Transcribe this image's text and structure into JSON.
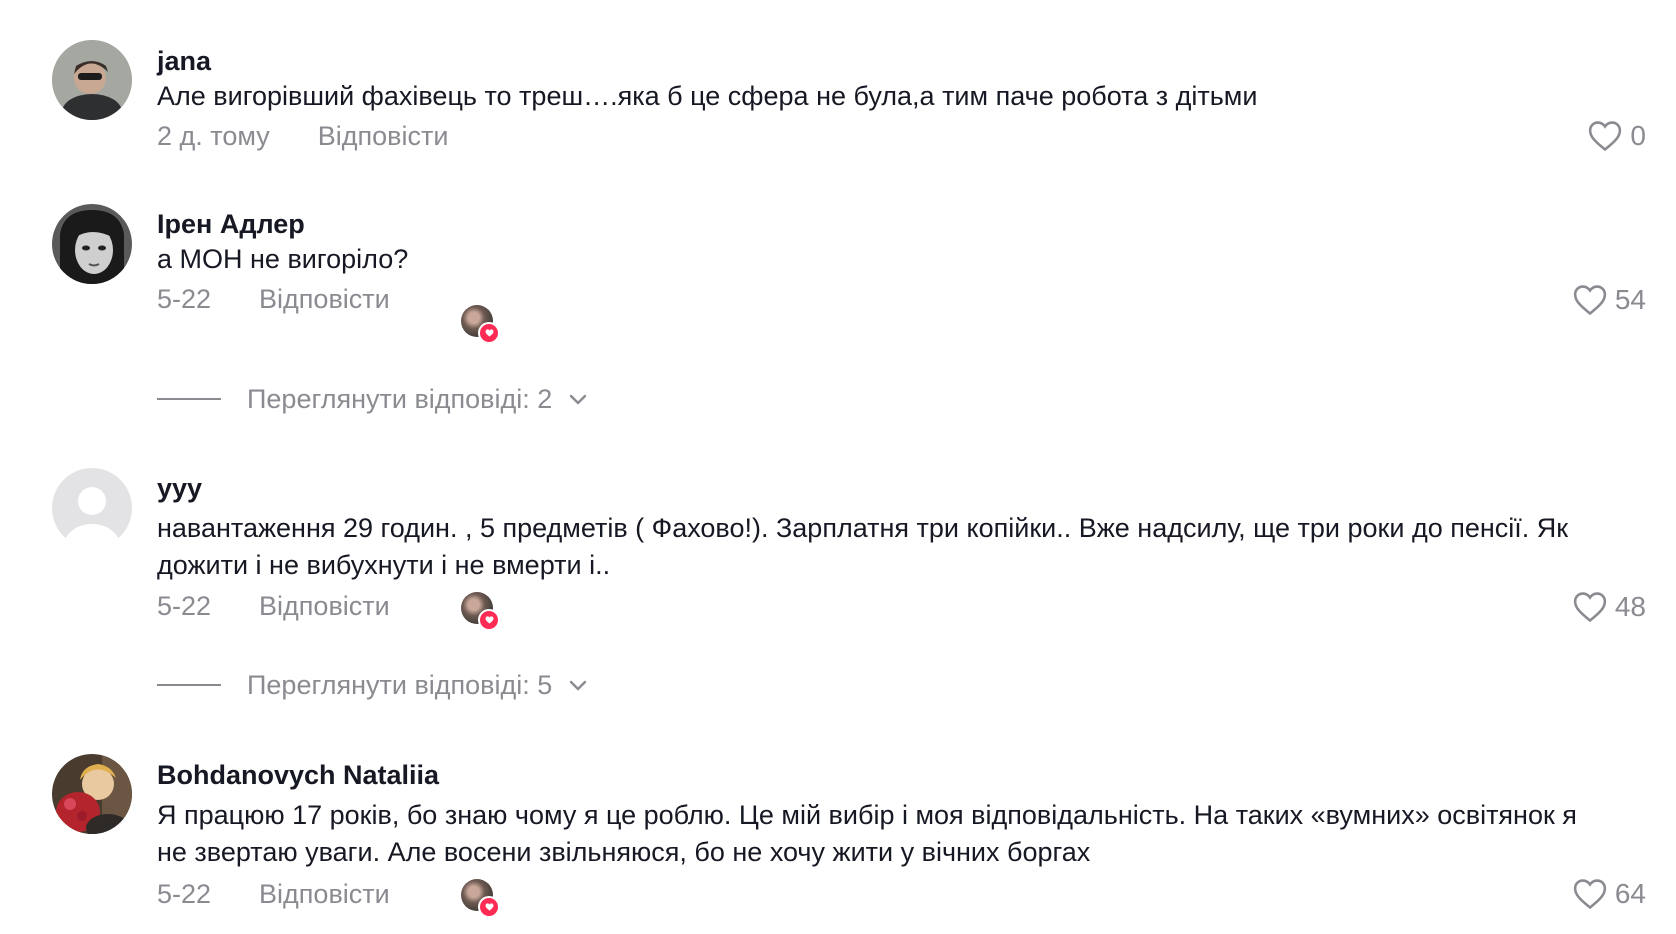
{
  "comments": [
    {
      "username": "jana",
      "text": "Але вигорівший фахівець то треш….яка б це сфера не була,а тим паче робота з дітьми",
      "time": "2 д. тому",
      "reply_label": "Відповісти",
      "likes": "0",
      "avatar_color": "#7a7e78"
    },
    {
      "username": "Ірен Адлер",
      "text": "а МОН не вигоріло?",
      "time": "5-22",
      "reply_label": "Відповісти",
      "likes": "54",
      "avatar_color": "#2b2b2b",
      "view_replies": "Переглянути відповіді: 2"
    },
    {
      "username": "yyy",
      "text": "навантаження 29 годин. , 5 предметів ( Фахово!). Зарплатня три копійки.. Вже надсилу, ще три роки до пенсії. Як дожити і не вибухнути і не вмерти і..",
      "time": "5-22",
      "reply_label": "Відповісти",
      "likes": "48",
      "avatar_color": "#e0e0e3",
      "view_replies": "Переглянути відповіді: 5"
    },
    {
      "username": "Bohdanovych Nataliia",
      "text": "Я працюю 17 років, бо знаю чому я це роблю. Це мій вибір і моя відповідальність. На таких «вумних» освітянок я не звертаю уваги. Але восени звільняюся, бо не хочу жити у вічних боргах",
      "time": "5-22",
      "reply_label": "Відповісти",
      "likes": "64",
      "avatar_color": "#c0392b"
    }
  ],
  "colors": {
    "secondary_text": "#8a8b91",
    "accent": "#fe2c55"
  }
}
